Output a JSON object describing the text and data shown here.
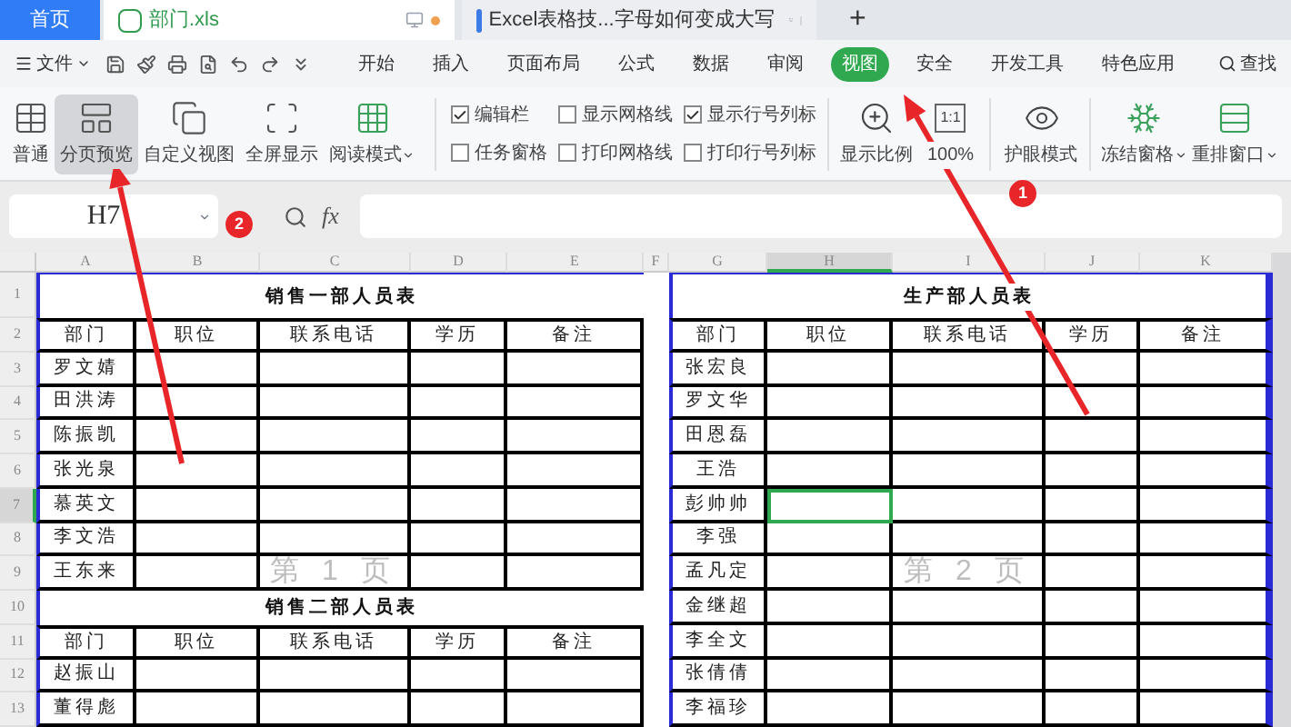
{
  "tabs": [
    {
      "label": "首页",
      "kind": "home",
      "selected": false
    },
    {
      "label": "部门.xls",
      "kind": "sheet",
      "selected": true
    },
    {
      "label": "Excel表格技...字母如何变成大写",
      "kind": "doc",
      "selected": false
    }
  ],
  "new_tab": "+",
  "file_menu": "文件",
  "menu": [
    {
      "label": "开始",
      "selected": false
    },
    {
      "label": "插入",
      "selected": false
    },
    {
      "label": "页面布局",
      "selected": false
    },
    {
      "label": "公式",
      "selected": false
    },
    {
      "label": "数据",
      "selected": false
    },
    {
      "label": "审阅",
      "selected": false
    },
    {
      "label": "视图",
      "selected": true
    },
    {
      "label": "安全",
      "selected": false
    },
    {
      "label": "开发工具",
      "selected": false
    },
    {
      "label": "特色应用",
      "selected": false
    }
  ],
  "search": "查找",
  "view_buttons": [
    {
      "label": "普通",
      "selected": false,
      "dropdown": false
    },
    {
      "label": "分页预览",
      "selected": true,
      "dropdown": false
    },
    {
      "label": "自定义视图",
      "selected": false,
      "dropdown": false
    },
    {
      "label": "全屏显示",
      "selected": false,
      "dropdown": false
    },
    {
      "label": "阅读模式",
      "selected": false,
      "dropdown": true
    }
  ],
  "checkboxes": [
    {
      "label": "编辑栏",
      "checked": true
    },
    {
      "label": "任务窗格",
      "checked": false
    },
    {
      "label": "显示网格线",
      "checked": false
    },
    {
      "label": "打印网格线",
      "checked": false
    },
    {
      "label": "显示行号列标",
      "checked": true
    },
    {
      "label": "打印行号列标",
      "checked": false
    }
  ],
  "zoom_label": "显示比例",
  "actual_size_icon": "1:1",
  "actual_size_label": "100%",
  "eye_care": "护眼模式",
  "window_buttons": [
    {
      "label": "冻结窗格"
    },
    {
      "label": "重排窗口"
    }
  ],
  "name_box": "H7",
  "fx": "fx",
  "sheet": {
    "columns": [
      {
        "label": "A",
        "selected": false
      },
      {
        "label": "B",
        "selected": false
      },
      {
        "label": "C",
        "selected": false
      },
      {
        "label": "D",
        "selected": false
      },
      {
        "label": "E",
        "selected": false
      },
      {
        "label": "F",
        "selected": false
      },
      {
        "label": "G",
        "selected": false
      },
      {
        "label": "H",
        "selected": true
      },
      {
        "label": "I",
        "selected": false
      },
      {
        "label": "J",
        "selected": false
      },
      {
        "label": "K",
        "selected": false
      }
    ],
    "rows": [
      {
        "label": "1",
        "selected": false
      },
      {
        "label": "2",
        "selected": false
      },
      {
        "label": "3",
        "selected": false
      },
      {
        "label": "4",
        "selected": false
      },
      {
        "label": "5",
        "selected": false
      },
      {
        "label": "6",
        "selected": false
      },
      {
        "label": "7",
        "selected": true
      },
      {
        "label": "8",
        "selected": false
      },
      {
        "label": "9",
        "selected": false
      },
      {
        "label": "10",
        "selected": false
      },
      {
        "label": "11",
        "selected": false
      },
      {
        "label": "12",
        "selected": false
      },
      {
        "label": "13",
        "selected": false
      }
    ],
    "pages": [
      {
        "label": "第 1 页",
        "tables": [
          {
            "title": "销售一部人员表",
            "headers": [
              "部门",
              "职位",
              "联系电话",
              "学历",
              "备注"
            ],
            "rows": [
              {
                "name": "罗文婧",
                "selected": false
              },
              {
                "name": "田洪涛",
                "selected": false
              },
              {
                "name": "陈振凯",
                "selected": false
              },
              {
                "name": "张光泉",
                "selected": false
              },
              {
                "name": "慕英文",
                "selected": false
              },
              {
                "name": "李文浩",
                "selected": false
              },
              {
                "name": "王东来",
                "selected": false
              }
            ]
          },
          {
            "title": "销售二部人员表",
            "headers": [
              "部门",
              "职位",
              "联系电话",
              "学历",
              "备注"
            ],
            "rows": [
              {
                "name": "赵振山",
                "selected": false
              },
              {
                "name": "董得彪",
                "selected": false
              }
            ]
          }
        ]
      },
      {
        "label": "第 2 页",
        "tables": [
          {
            "title": "生产部人员表",
            "headers": [
              "部门",
              "职位",
              "联系电话",
              "学历",
              "备注"
            ],
            "rows": [
              {
                "name": "张宏良",
                "selected": false
              },
              {
                "name": "罗文华",
                "selected": false
              },
              {
                "name": "田恩磊",
                "selected": false
              },
              {
                "name": "王浩",
                "selected": false
              },
              {
                "name": "彭帅帅",
                "selected": true
              },
              {
                "name": "李强",
                "selected": false
              },
              {
                "name": "孟凡定",
                "selected": false
              },
              {
                "name": "金继超",
                "selected": false
              },
              {
                "name": "李全文",
                "selected": false
              },
              {
                "name": "张倩倩",
                "selected": false
              },
              {
                "name": "李福珍",
                "selected": false
              }
            ]
          }
        ]
      }
    ]
  },
  "annotations": [
    {
      "label": "1"
    },
    {
      "label": "2"
    }
  ]
}
